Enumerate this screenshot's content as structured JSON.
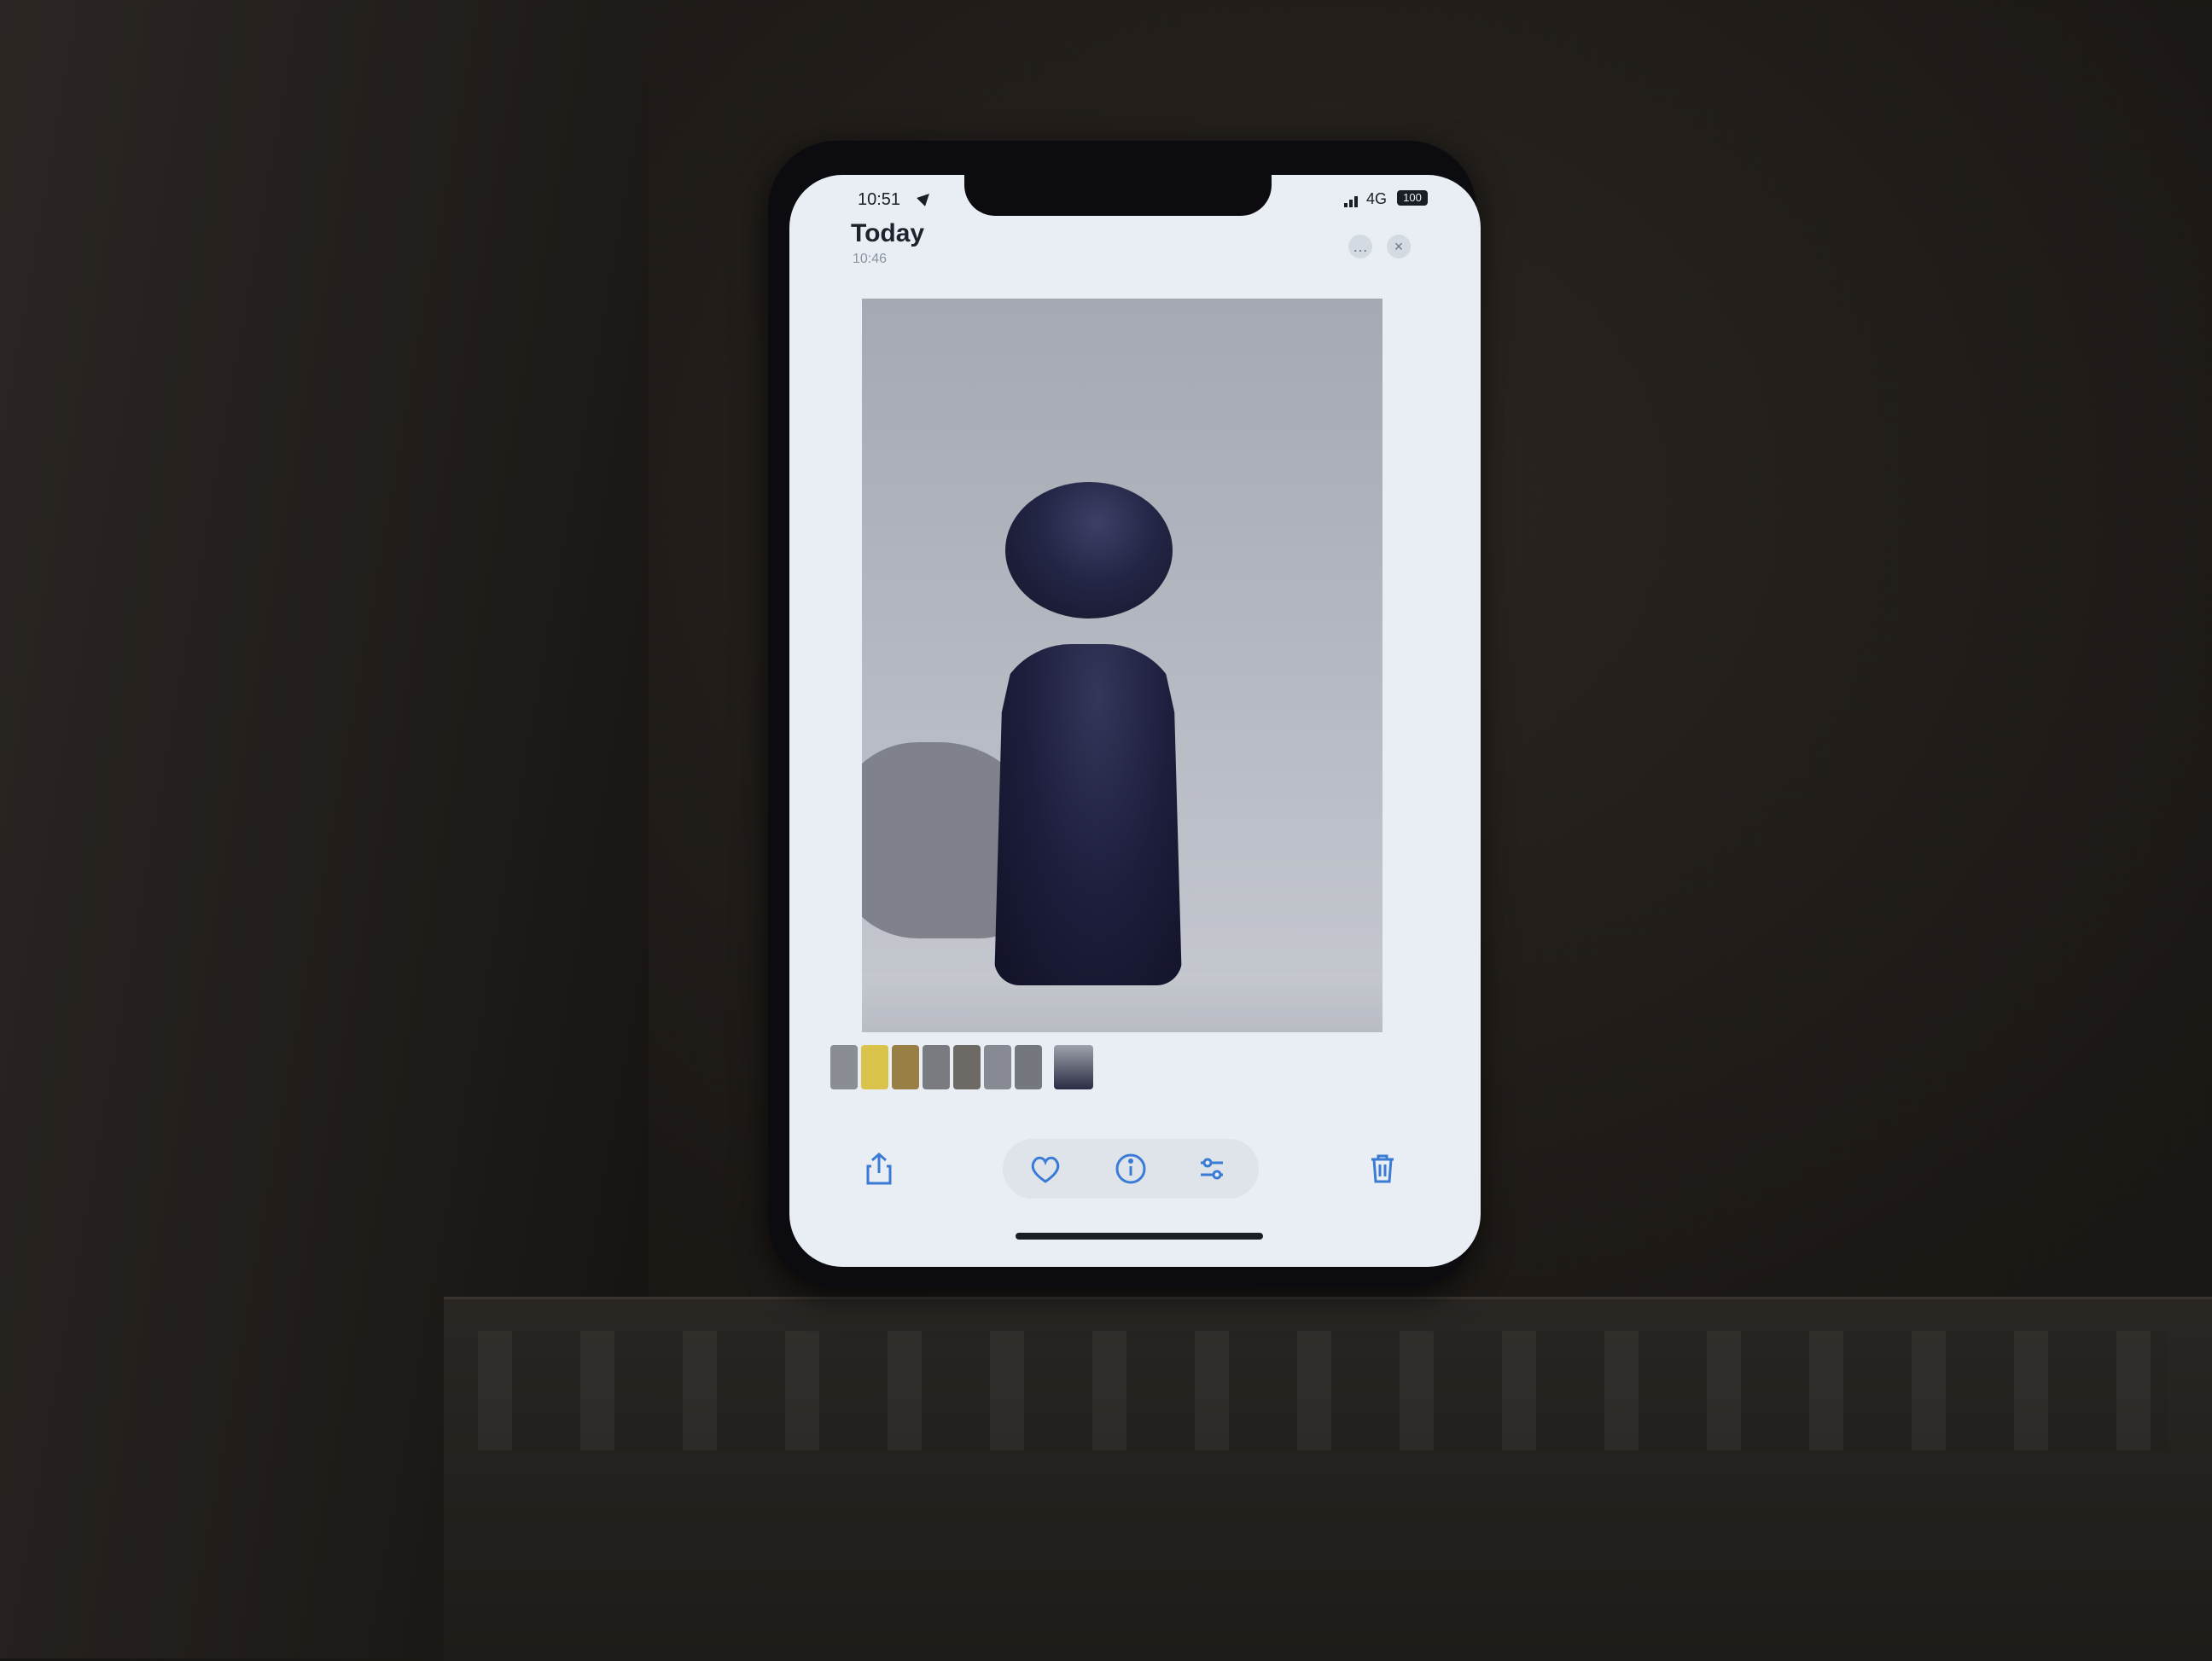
{
  "status_bar": {
    "time": "10:51",
    "network": "4G",
    "battery": "100"
  },
  "header": {
    "title": "Today",
    "subtitle": "10:46"
  },
  "photo": {
    "subject": "pawn"
  },
  "icons": {
    "share": "share-icon",
    "favorite": "heart-icon",
    "info": "info-icon",
    "edit": "sliders-icon",
    "delete": "trash-icon"
  },
  "colors": {
    "accent": "#3a7bd5",
    "screen_bg": "#e9eef4"
  }
}
